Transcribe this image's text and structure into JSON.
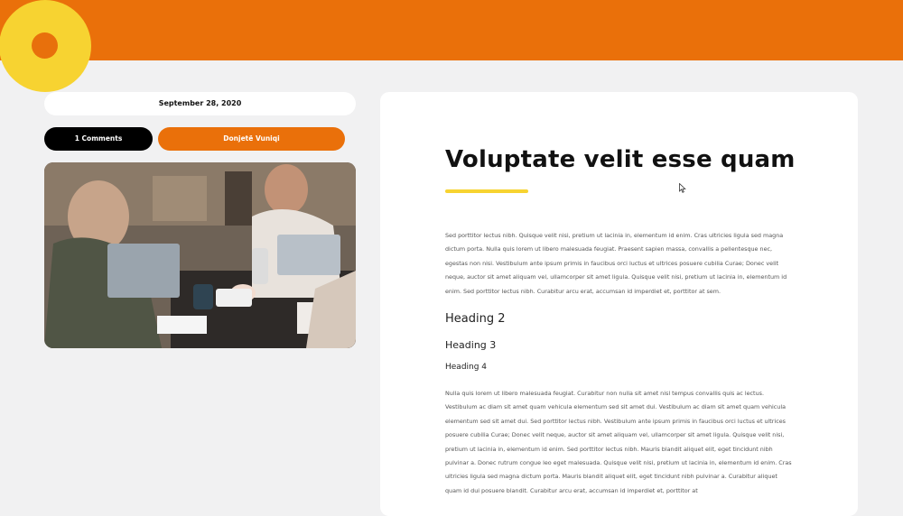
{
  "header": {
    "brand_colors": {
      "bar": "#ea700a",
      "logo": "#f7d331"
    }
  },
  "meta": {
    "date": "September 28, 2020",
    "comments": "1 Comments",
    "author": "Donjetë Vuniqi"
  },
  "featured_image": {
    "description_icon": "photo"
  },
  "article": {
    "title": "Voluptate velit esse quam",
    "intro": "Sed porttitor lectus nibh. Quisque velit nisi, pretium ut lacinia in, elementum id enim. Cras ultricies ligula sed magna dictum porta. Nulla quis lorem ut libero malesuada feugiat. Praesent sapien massa, convallis a pellentesque nec, egestas non nisi. Vestibulum ante ipsum primis in faucibus orci luctus et ultrices posuere cubilia Curae; Donec velit neque, auctor sit amet aliquam vel, ullamcorper sit amet ligula. Quisque velit nisi, pretium ut lacinia in, elementum id enim. Sed porttitor lectus nibh. Curabitur arcu erat, accumsan id imperdiet et, porttitor at sem.",
    "heading2": "Heading 2",
    "heading3": "Heading 3",
    "heading4": "Heading 4",
    "body": "Nulla quis lorem ut libero malesuada feugiat. Curabitur non nulla sit amet nisl tempus convallis quis ac lectus. Vestibulum ac diam sit amet quam vehicula elementum sed sit amet dui. Vestibulum ac diam sit amet quam vehicula elementum sed sit amet dui. Sed porttitor lectus nibh. Vestibulum ante ipsum primis in faucibus orci luctus et ultrices posuere cubilia Curae; Donec velit neque, auctor sit amet aliquam vel, ullamcorper sit amet ligula. Quisque velit nisi, pretium ut lacinia in, elementum id enim. Sed porttitor lectus nibh. Mauris blandit aliquet elit, eget tincidunt nibh pulvinar a. Donec rutrum congue leo eget malesuada. Quisque velit nisi, pretium ut lacinia in, elementum id enim. Cras ultricies ligula sed magna dictum porta. Mauris blandit aliquet elit, eget tincidunt nibh pulvinar a. Curabitur aliquet quam id dui posuere blandit. Curabitur arcu erat, accumsan id imperdiet et, porttitor at"
  }
}
